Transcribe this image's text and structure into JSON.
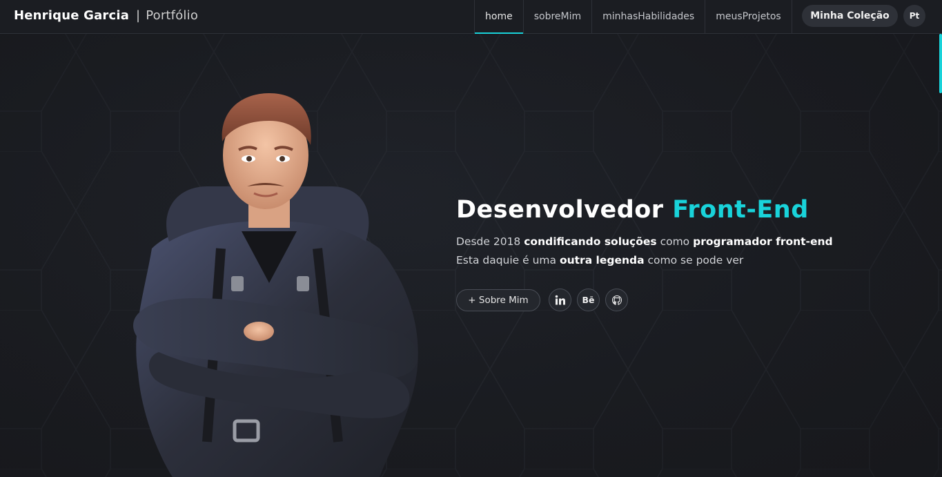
{
  "navbar": {
    "brand_name": "Henrique Garcia",
    "brand_separator": "|",
    "brand_sub": "Portfólio",
    "links": [
      {
        "label": "home",
        "active": true
      },
      {
        "label": "sobreMim",
        "active": false
      },
      {
        "label": "minhasHabilidades",
        "active": false
      },
      {
        "label": "meusProjetos",
        "active": false
      }
    ],
    "collection_button": "Minha Coleção",
    "language_button": "Pt"
  },
  "hero": {
    "title_main": "Desenvolvedor",
    "title_accent": "Front-End",
    "line1": {
      "t1": "Desde 2018",
      "b1": "condificando soluções",
      "t2": "como",
      "b2": "programador front-end"
    },
    "line2": {
      "t1": "Esta daquie é uma",
      "b1": "outra legenda",
      "t2": "como se pode ver"
    },
    "about_button": "+ Sobre Mim",
    "social": [
      {
        "icon": "linkedin-icon",
        "text": "in"
      },
      {
        "icon": "behance-icon",
        "text": "Bē"
      },
      {
        "icon": "github-icon",
        "text": ""
      }
    ]
  },
  "colors": {
    "accent": "#19d3da",
    "background": "#1b1d22",
    "button_bg": "#2e3138"
  }
}
